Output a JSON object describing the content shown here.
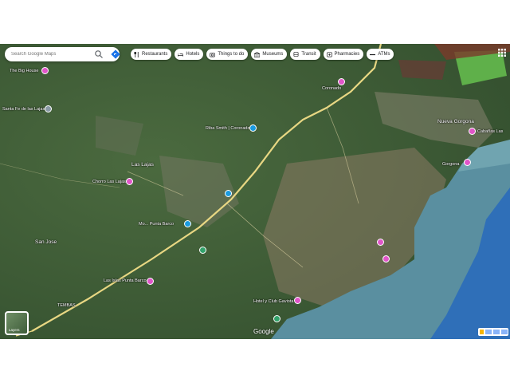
{
  "search": {
    "placeholder": "Search Google Maps",
    "search_icon": "search-icon",
    "directions_icon": "directions-icon"
  },
  "chips": [
    {
      "label": "Restaurants",
      "icon": "fork-knife-icon"
    },
    {
      "label": "Hotels",
      "icon": "bed-icon"
    },
    {
      "label": "Things to do",
      "icon": "camera-icon"
    },
    {
      "label": "Museums",
      "icon": "museum-icon"
    },
    {
      "label": "Transit",
      "icon": "bus-icon"
    },
    {
      "label": "Pharmacies",
      "icon": "pharmacy-icon"
    },
    {
      "label": "ATMs",
      "icon": "atm-icon"
    }
  ],
  "places": {
    "big_house": "The Big House",
    "santa_fe": "Santa Fe de las Lajas",
    "las_lajas": "Las Lajas",
    "chorro": "Chorro Las Lajas",
    "riba_smith": "Riba Smith | Coronado",
    "san_jose": "San Jose",
    "punta_barco_1": "Mo... Punta Barco",
    "las_islas": "Las Islas Punta Barco",
    "hotel_gaviota": "Hotel y Club Gaviota",
    "nueva_gorgona": "Nueva Gorgona",
    "cabanas": "Cabañas Las",
    "coronado_top": "Coronado",
    "gorgona": "Gorgona",
    "tembas": "TEMBAS"
  },
  "controls": {
    "layers_label": "Layers",
    "logo": "Google"
  },
  "colors": {
    "pin_pink": "#e155c9",
    "pin_blue": "#1a9be0",
    "road": "#f3e08a",
    "sea": "#4d7f8f"
  }
}
